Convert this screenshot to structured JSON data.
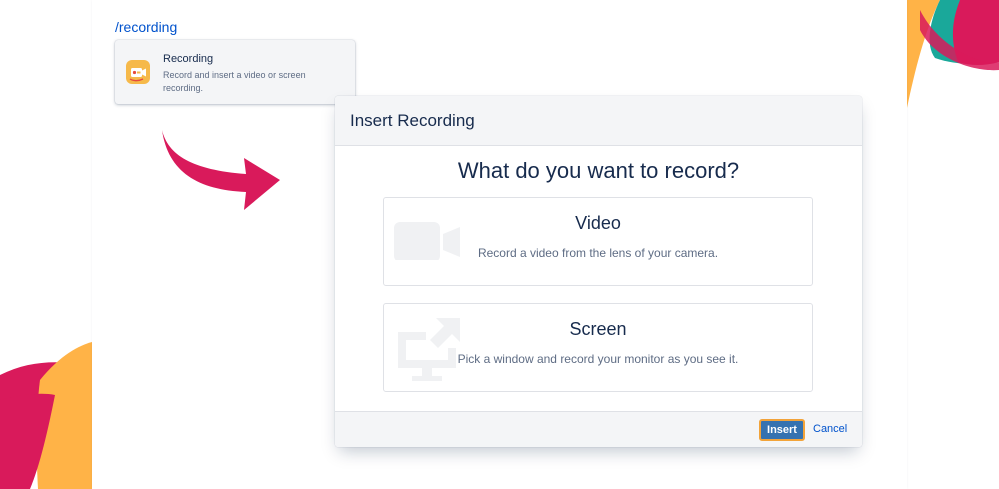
{
  "editor": {
    "slash_command": "/recording"
  },
  "suggestion": {
    "title": "Recording",
    "description": "Record and insert a video or screen recording.",
    "icon": "recording-macro-icon"
  },
  "dialog": {
    "title": "Insert Recording",
    "question": "What do you want to record?",
    "options": [
      {
        "title": "Video",
        "description": "Record a video from the lens of your camera.",
        "icon": "video-camera-icon"
      },
      {
        "title": "Screen",
        "description": "Pick a window and record your monitor as you see it.",
        "icon": "monitor-share-icon"
      }
    ],
    "insert_label": "Insert",
    "cancel_label": "Cancel"
  },
  "colors": {
    "accent_magenta": "#d91a5b",
    "accent_orange": "#ffb347",
    "accent_teal": "#1aa89a",
    "primary_button": "#3572b0",
    "link": "#0052cc"
  }
}
